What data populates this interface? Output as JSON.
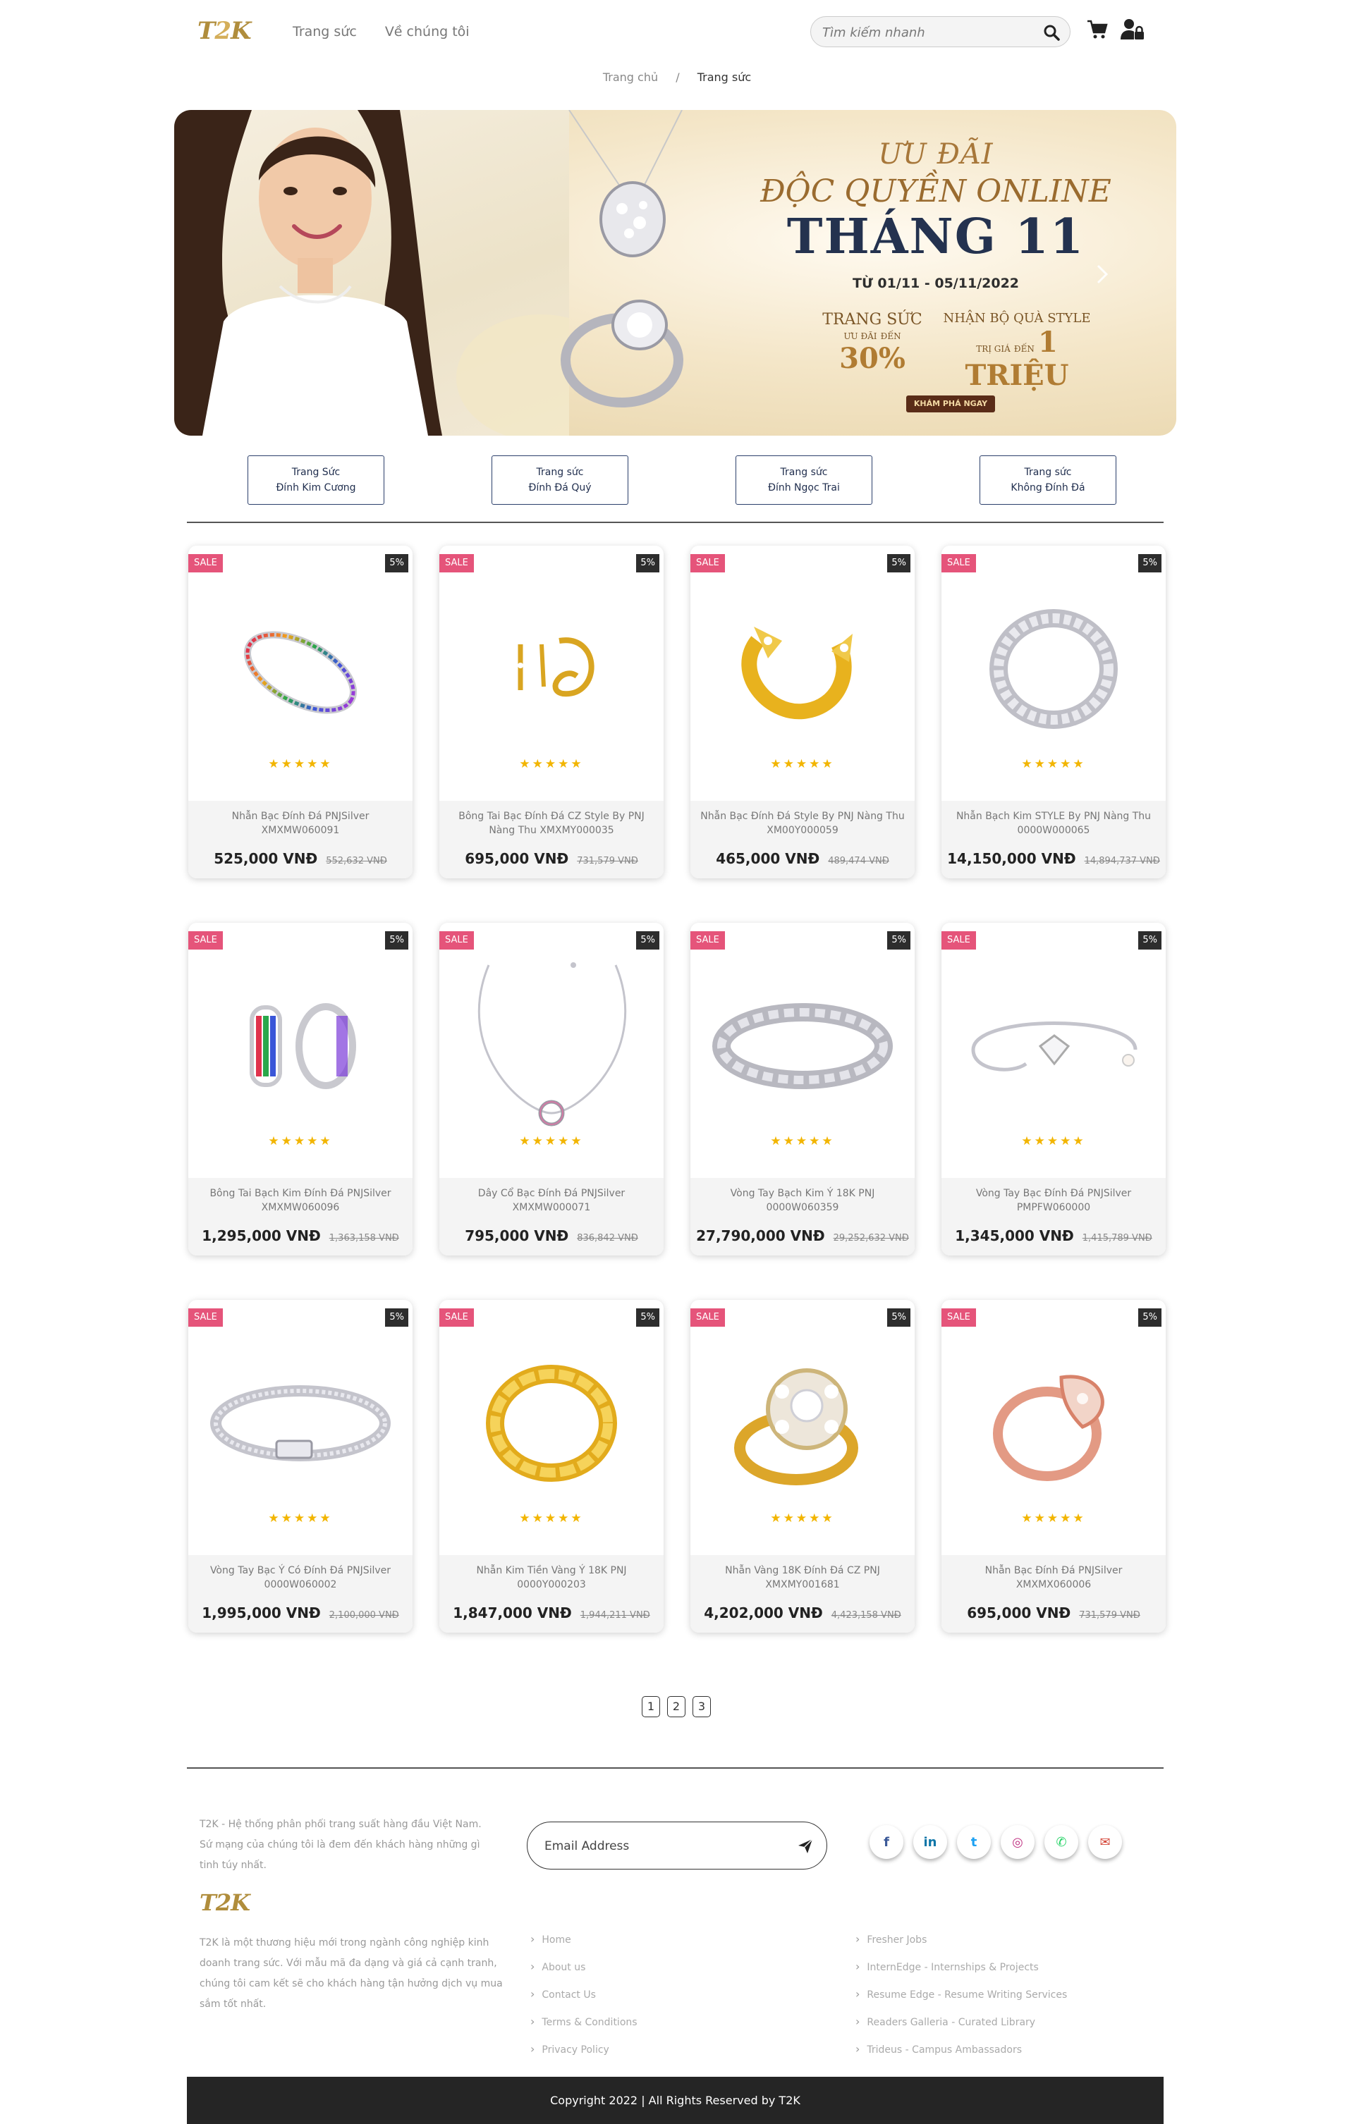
{
  "header": {
    "logo_left": "T",
    "logo_mid": "2",
    "logo_right": "K",
    "nav": [
      "Trang sức",
      "Về chúng tôi"
    ],
    "search_placeholder": "Tìm kiếm nhanh"
  },
  "breadcrumb": {
    "home": "Trang chủ",
    "separator": "/",
    "current": "Trang sức"
  },
  "banner": {
    "line1": "ƯU ĐÃI",
    "line2": "ĐỘC QUYỀN ONLINE",
    "line3": "THÁNG 11",
    "dates": "TỪ 01/11 - 05/11/2022",
    "promo1_title": "TRANG SỨC",
    "promo1_small1": "ƯU ĐÃI",
    "promo1_small2": "ĐẾN",
    "promo1_value": "30%",
    "promo2_title": "NHẬN BỘ QUÀ STYLE",
    "promo2_small1": "TRỊ GIÁ",
    "promo2_small2": "ĐẾN",
    "promo2_value": "1 TRIỆU",
    "cta": "KHÁM PHÁ NGAY"
  },
  "categories": [
    {
      "line1": "Trang Sức",
      "line2": "Đính Kim Cương"
    },
    {
      "line1": "Trang sức",
      "line2": "Đính Đá Quý"
    },
    {
      "line1": "Trang sức",
      "line2": "Đính Ngọc Trai"
    },
    {
      "line1": "Trang sức",
      "line2": "Không Đính Đá"
    }
  ],
  "product_labels": {
    "sale": "SALE",
    "discount": "5%",
    "stars": "★★★★★"
  },
  "products": [
    {
      "name": "Nhẫn Bạc Đính Đá PNJSilver XMXMW060091",
      "price": "525,000 VNĐ",
      "old_price": "552,632 VNĐ",
      "image": "rainbow-band-ring"
    },
    {
      "name": "Bông Tai Bạc Đính Đá CZ Style By PNJ Nàng Thu XMXMY000035",
      "price": "695,000 VNĐ",
      "old_price": "731,579 VNĐ",
      "image": "gold-earrings"
    },
    {
      "name": "Nhẫn Bạc Đính Đá Style By PNJ Nàng Thu XM00Y000059",
      "price": "465,000 VNĐ",
      "old_price": "489,474 VNĐ",
      "image": "gold-open-ring"
    },
    {
      "name": "Nhẫn Bạch Kim STYLE By PNJ Nàng Thu 0000W000065",
      "price": "14,150,000 VNĐ",
      "old_price": "14,894,737 VNĐ",
      "image": "silver-chain-ring"
    },
    {
      "name": "Bông Tai Bạch Kim Đính Đá PNJSilver XMXMW060096",
      "price": "1,295,000 VNĐ",
      "old_price": "1,363,158 VNĐ",
      "image": "rainbow-hoop-earrings"
    },
    {
      "name": "Dây Cổ Bạc Đính Đá PNJSilver XMXMW000071",
      "price": "795,000 VNĐ",
      "old_price": "836,842 VNĐ",
      "image": "silver-necklace"
    },
    {
      "name": "Vòng Tay Bạch Kim Ý 18K PNJ 0000W060359",
      "price": "27,790,000 VNĐ",
      "old_price": "29,252,632 VNĐ",
      "image": "silver-chain-bracelet"
    },
    {
      "name": "Vòng Tay Bạc Đính Đá PNJSilver PMPFW060000",
      "price": "1,345,000 VNĐ",
      "old_price": "1,415,789 VNĐ",
      "image": "silver-cuff-bracelet"
    },
    {
      "name": "Vòng Tay Bạc Ý Có Đính Đá PNJSilver 0000W060002",
      "price": "1,995,000 VNĐ",
      "old_price": "2,100,000 VNĐ",
      "image": "silver-braided-bangle"
    },
    {
      "name": "Nhẫn Kim Tiền Vàng Ý 18K PNJ 0000Y000203",
      "price": "1,847,000 VNĐ",
      "old_price": "1,944,211 VNĐ",
      "image": "gold-coin-ring"
    },
    {
      "name": "Nhẫn Vàng 18K Đính Đá CZ PNJ XMXMY001681",
      "price": "4,202,000 VNĐ",
      "old_price": "4,423,158 VNĐ",
      "image": "gold-cluster-ring"
    },
    {
      "name": "Nhẫn Bạc Đính Đá PNJSilver XMXMX060006",
      "price": "695,000 VNĐ",
      "old_price": "731,579 VNĐ",
      "image": "rose-gold-ring"
    }
  ],
  "pagination": [
    "1",
    "2",
    "3"
  ],
  "footer": {
    "desc1": "T2K - Hệ thống phân phối trang suất hàng đầu Việt Nam. Sứ mạng của chúng tôi là đem đến khách hàng những gì tinh túy nhất.",
    "logo": "T2K",
    "desc2": "T2K là một thương hiệu mới trong ngành công nghiệp kinh doanh trang sức. Với mẫu mã đa dạng và giá cả cạnh tranh, chúng tôi cam kết sẽ cho khách hàng tận hưởng dịch vụ mua sắm tốt nhất.",
    "email_placeholder": "Email Address",
    "socials": [
      {
        "icon": "facebook-icon",
        "glyph": "f",
        "color": "#3b5998"
      },
      {
        "icon": "linkedin-icon",
        "glyph": "in",
        "color": "#0e76a8"
      },
      {
        "icon": "twitter-icon",
        "glyph": "t",
        "color": "#1da1f2"
      },
      {
        "icon": "instagram-icon",
        "glyph": "◎",
        "color": "#c13584"
      },
      {
        "icon": "whatsapp-icon",
        "glyph": "✆",
        "color": "#25d366"
      },
      {
        "icon": "mail-icon",
        "glyph": "✉",
        "color": "#d44638"
      }
    ],
    "links_left": [
      "Home",
      "About us",
      "Contact Us",
      "Terms & Conditions",
      "Privacy Policy"
    ],
    "links_right": [
      "Fresher Jobs",
      "InternEdge - Internships & Projects",
      "Resume Edge - Resume Writing Services",
      "Readers Galleria - Curated Library",
      "Trideus - Campus Ambassadors"
    ],
    "copyright": "Copyright 2022 | All Rights Reserved by T2K"
  }
}
